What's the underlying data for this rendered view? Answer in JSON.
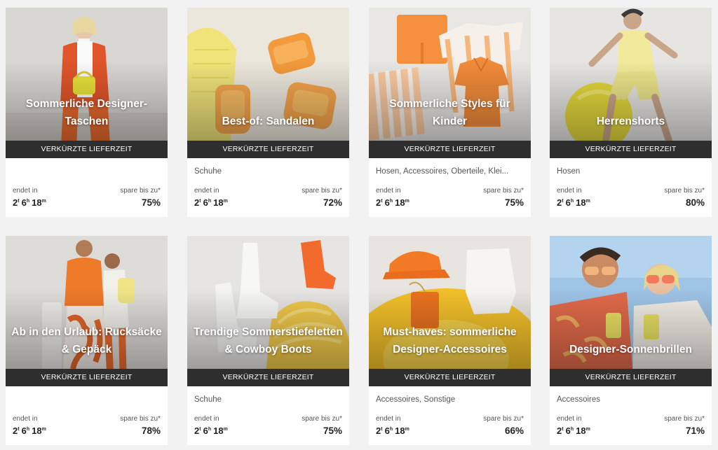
{
  "labels": {
    "delivery_badge": "VERKÜRZTE LIEFERZEIT",
    "ends_in": "endet in",
    "save_up_to": "spare bis zu*",
    "countdown_days": "2",
    "countdown_days_unit": "t",
    "countdown_hours": "6",
    "countdown_hours_unit": "h",
    "countdown_minutes": "18",
    "countdown_minutes_unit": "m"
  },
  "cards": [
    {
      "title": "Sommerliche Designer-Taschen",
      "category": "",
      "discount": "75%",
      "image": "woman-with-yellow-bag-photo"
    },
    {
      "title": "Best-of: Sandalen",
      "category": "Schuhe",
      "discount": "72%",
      "image": "orange-sandals-photo"
    },
    {
      "title": "Sommerliche Styles für Kinder",
      "category": "Hosen, Accessoires, Oberteile, Klei...",
      "discount": "75%",
      "image": "kids-orange-clothes-photo"
    },
    {
      "title": "Herrenshorts",
      "category": "Hosen",
      "discount": "80%",
      "image": "man-yellow-shorts-photo"
    },
    {
      "title": "Ab in den Urlaub: Rucksäcke & Gepäck",
      "category": "",
      "discount": "78%",
      "image": "travelers-with-luggage-photo"
    },
    {
      "title": "Trendige Sommerstiefeletten & Cowboy Boots",
      "category": "Schuhe",
      "discount": "75%",
      "image": "white-cowboy-boots-photo"
    },
    {
      "title": "Must-haves: sommerliche Designer-Accessoires",
      "category": "Accessoires, Sonstige",
      "discount": "66%",
      "image": "orange-cap-accessories-photo"
    },
    {
      "title": "Designer-Sonnenbrillen",
      "category": "Accessoires",
      "discount": "71%",
      "image": "couple-sunglasses-photo"
    }
  ]
}
